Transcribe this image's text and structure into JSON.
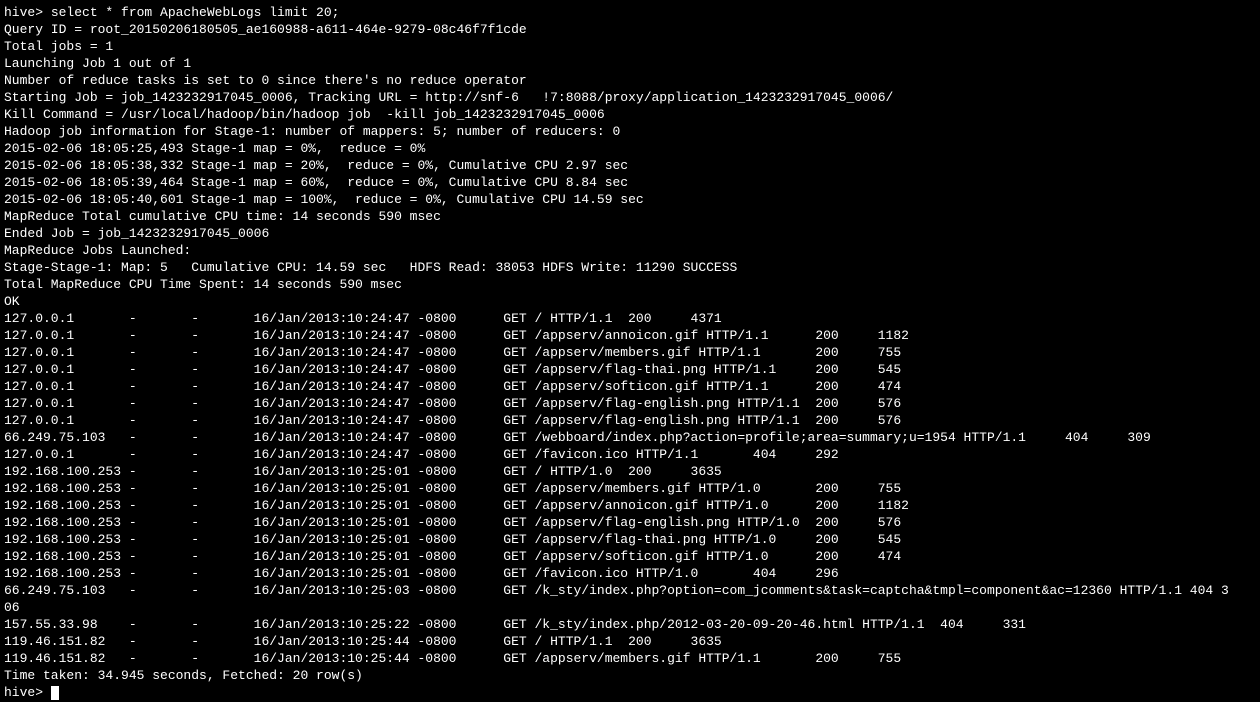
{
  "terminal": {
    "prompt1": "hive> ",
    "cmd": "select * from ApacheWebLogs limit 20;",
    "header": [
      "Query ID = root_20150206180505_ae160988-a611-464e-9279-08c46f7f1cde",
      "Total jobs = 1",
      "Launching Job 1 out of 1",
      "Number of reduce tasks is set to 0 since there's no reduce operator",
      "Starting Job = job_1423232917045_0006, Tracking URL = http://snf-6   !7:8088/proxy/application_1423232917045_0006/",
      "Kill Command = /usr/local/hadoop/bin/hadoop job  -kill job_1423232917045_0006",
      "Hadoop job information for Stage-1: number of mappers: 5; number of reducers: 0",
      "2015-02-06 18:05:25,493 Stage-1 map = 0%,  reduce = 0%",
      "2015-02-06 18:05:38,332 Stage-1 map = 20%,  reduce = 0%, Cumulative CPU 2.97 sec",
      "2015-02-06 18:05:39,464 Stage-1 map = 60%,  reduce = 0%, Cumulative CPU 8.84 sec",
      "2015-02-06 18:05:40,601 Stage-1 map = 100%,  reduce = 0%, Cumulative CPU 14.59 sec",
      "MapReduce Total cumulative CPU time: 14 seconds 590 msec",
      "Ended Job = job_1423232917045_0006",
      "MapReduce Jobs Launched:",
      "Stage-Stage-1: Map: 5   Cumulative CPU: 14.59 sec   HDFS Read: 38053 HDFS Write: 11290 SUCCESS",
      "Total MapReduce CPU Time Spent: 14 seconds 590 msec",
      "OK"
    ],
    "rows": [
      "127.0.0.1       -       -       16/Jan/2013:10:24:47 -0800      GET / HTTP/1.1  200     4371",
      "127.0.0.1       -       -       16/Jan/2013:10:24:47 -0800      GET /appserv/annoicon.gif HTTP/1.1      200     1182",
      "127.0.0.1       -       -       16/Jan/2013:10:24:47 -0800      GET /appserv/members.gif HTTP/1.1       200     755",
      "127.0.0.1       -       -       16/Jan/2013:10:24:47 -0800      GET /appserv/flag-thai.png HTTP/1.1     200     545",
      "127.0.0.1       -       -       16/Jan/2013:10:24:47 -0800      GET /appserv/softicon.gif HTTP/1.1      200     474",
      "127.0.0.1       -       -       16/Jan/2013:10:24:47 -0800      GET /appserv/flag-english.png HTTP/1.1  200     576",
      "127.0.0.1       -       -       16/Jan/2013:10:24:47 -0800      GET /appserv/flag-english.png HTTP/1.1  200     576",
      "66.249.75.103   -       -       16/Jan/2013:10:24:47 -0800      GET /webboard/index.php?action=profile;area=summary;u=1954 HTTP/1.1     404     309",
      "127.0.0.1       -       -       16/Jan/2013:10:24:47 -0800      GET /favicon.ico HTTP/1.1       404     292",
      "192.168.100.253 -       -       16/Jan/2013:10:25:01 -0800      GET / HTTP/1.0  200     3635",
      "192.168.100.253 -       -       16/Jan/2013:10:25:01 -0800      GET /appserv/members.gif HTTP/1.0       200     755",
      "192.168.100.253 -       -       16/Jan/2013:10:25:01 -0800      GET /appserv/annoicon.gif HTTP/1.0      200     1182",
      "192.168.100.253 -       -       16/Jan/2013:10:25:01 -0800      GET /appserv/flag-english.png HTTP/1.0  200     576",
      "192.168.100.253 -       -       16/Jan/2013:10:25:01 -0800      GET /appserv/flag-thai.png HTTP/1.0     200     545",
      "192.168.100.253 -       -       16/Jan/2013:10:25:01 -0800      GET /appserv/softicon.gif HTTP/1.0      200     474",
      "192.168.100.253 -       -       16/Jan/2013:10:25:01 -0800      GET /favicon.ico HTTP/1.0       404     296",
      "66.249.75.103   -       -       16/Jan/2013:10:25:03 -0800      GET /k_sty/index.php?option=com_jcomments&task=captcha&tmpl=component&ac=12360 HTTP/1.1 404 3",
      "06",
      "157.55.33.98    -       -       16/Jan/2013:10:25:22 -0800      GET /k_sty/index.php/2012-03-20-09-20-46.html HTTP/1.1  404     331",
      "119.46.151.82   -       -       16/Jan/2013:10:25:44 -0800      GET / HTTP/1.1  200     3635",
      "119.46.151.82   -       -       16/Jan/2013:10:25:44 -0800      GET /appserv/members.gif HTTP/1.1       200     755"
    ],
    "footer": "Time taken: 34.945 seconds, Fetched: 20 row(s)",
    "prompt2": "hive> "
  }
}
